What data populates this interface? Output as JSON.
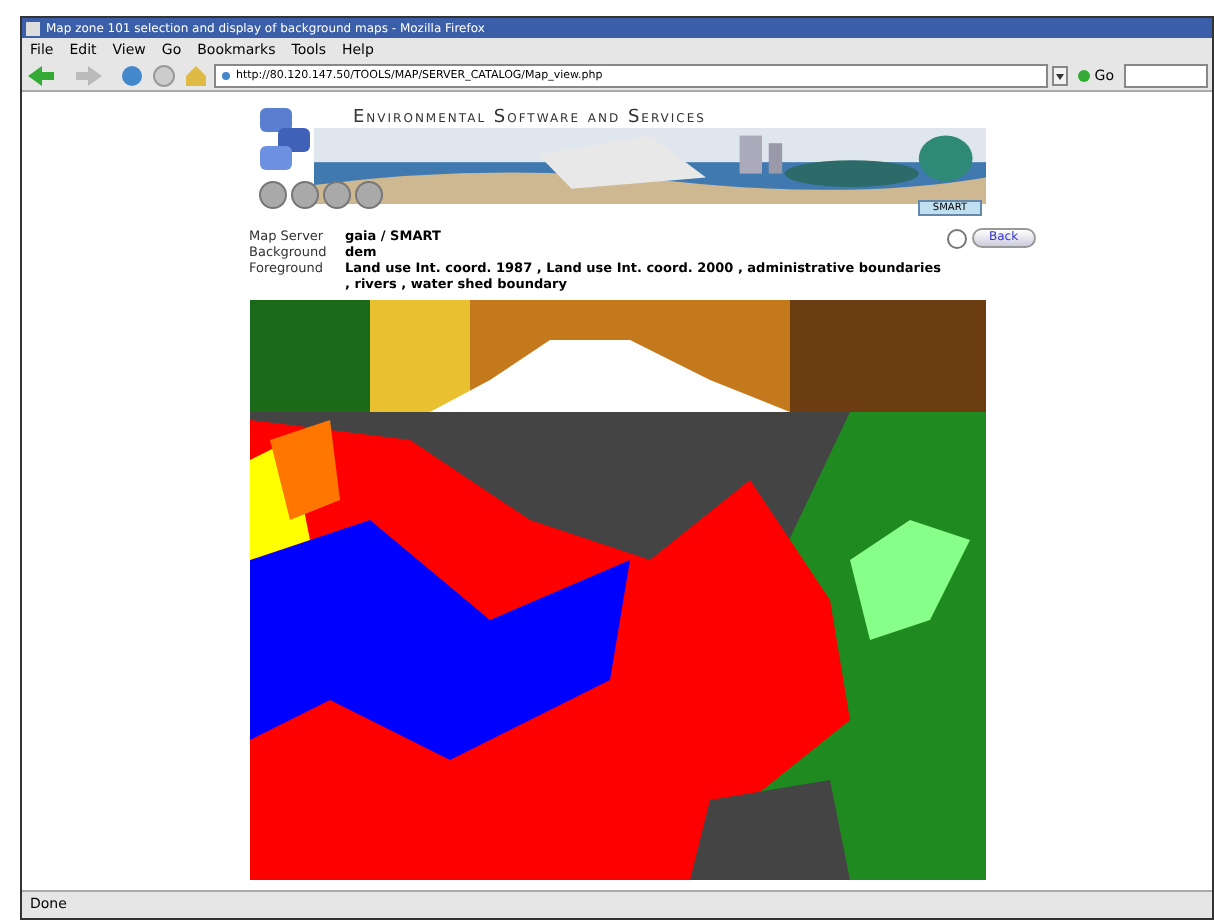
{
  "window": {
    "title": "Map zone 101 selection and display of background maps - Mozilla Firefox"
  },
  "menu": [
    "File",
    "Edit",
    "View",
    "Go",
    "Bookmarks",
    "Tools",
    "Help"
  ],
  "address": {
    "value": "http://80.120.147.50/TOOLS/MAP/SERVER_CATALOG/Map_view.php",
    "go": "Go"
  },
  "banner": {
    "title": "Environmental Software and Services",
    "badge": "SMART"
  },
  "back": "Back",
  "info": [
    {
      "label": "Map Server",
      "value": "gaia / SMART"
    },
    {
      "label": "Background",
      "value": "dem"
    },
    {
      "label": "Foreground",
      "value": "Land use Int. coord. 1987 , Land use Int. coord. 2000 , administrative boundaries , rivers , water shed boundary"
    }
  ],
  "status_bar": "Done"
}
